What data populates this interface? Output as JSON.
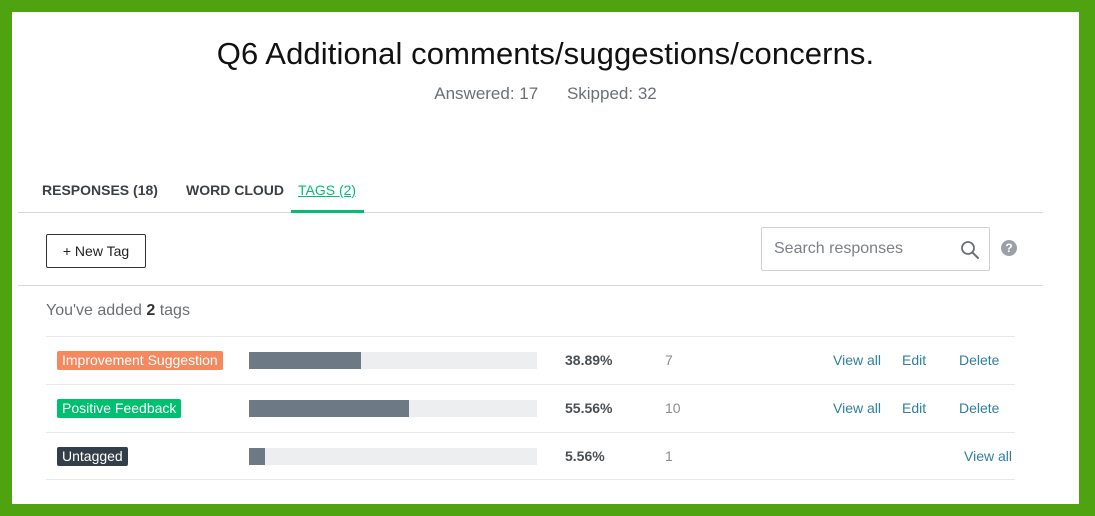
{
  "question": {
    "title": "Q6 Additional comments/suggestions/concerns.",
    "answered_label": "Answered: 17",
    "skipped_label": "Skipped: 32"
  },
  "tabs": [
    {
      "label": "RESPONSES (18)",
      "active": false
    },
    {
      "label": "WORD CLOUD",
      "active": false
    },
    {
      "label": "TAGS (2)",
      "active": true
    }
  ],
  "toolbar": {
    "new_tag_label": "+ New Tag",
    "search_placeholder": "Search responses",
    "search_icon": "search-icon",
    "help_icon": "?"
  },
  "summary": {
    "prefix": "You've added ",
    "count": "2",
    "suffix": " tags"
  },
  "tags": [
    {
      "name": "Improvement Suggestion",
      "color": "#f4895f",
      "percent_label": "38.89%",
      "percent_value": 38.89,
      "count": "7",
      "view_all": "View all",
      "edit": "Edit",
      "delete": "Delete"
    },
    {
      "name": "Positive Feedback",
      "color": "#00bf6f",
      "percent_label": "55.56%",
      "percent_value": 55.56,
      "count": "10",
      "view_all": "View all",
      "edit": "Edit",
      "delete": "Delete"
    },
    {
      "name": "Untagged",
      "color": "#333e48",
      "percent_label": "5.56%",
      "percent_value": 5.56,
      "count": "1",
      "view_all": "View all"
    }
  ],
  "colors": {
    "frame_border": "#4fa310",
    "accent": "#00bf6f",
    "bar_fill": "#6d7a85",
    "bar_track": "#eceeef",
    "link": "#2f7fa3"
  }
}
